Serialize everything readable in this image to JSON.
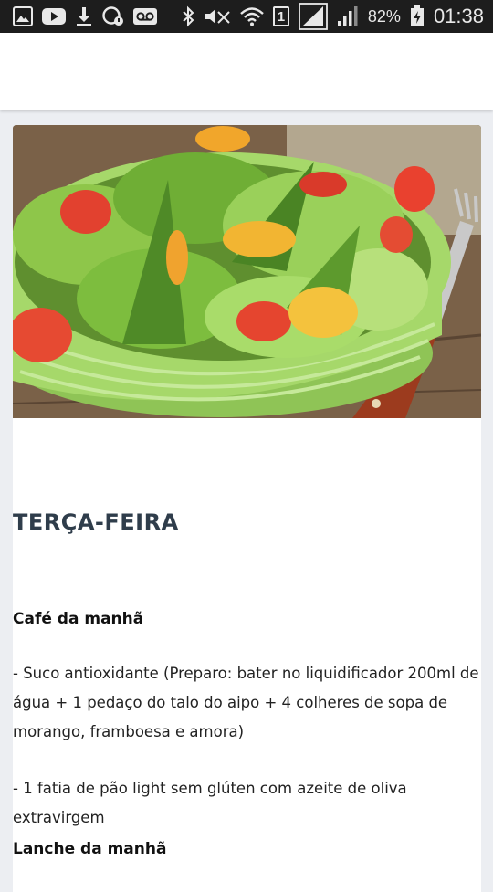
{
  "status_bar": {
    "battery_percent": "82%",
    "time": "01:38",
    "sim_label": "1",
    "left_icons": [
      "gallery-icon",
      "youtube-icon",
      "download-icon",
      "whatsapp-icon",
      "voicemail-icon"
    ],
    "right_icons": [
      "bluetooth-icon",
      "mute-icon",
      "wifi-icon",
      "sim-icon",
      "signal-icon",
      "signal-icon",
      "battery-charging-icon"
    ]
  },
  "colors": {
    "status_bar_bg": "#1d1d1d",
    "page_bg": "#eceef2",
    "title_color": "#2f3d4b",
    "bowl_green": "#a6d86a"
  },
  "article": {
    "hero_image": "salad-bowl-image",
    "day_title": "TERÇA-FEIRA",
    "meals": [
      {
        "title": "Café da manhã",
        "items": [
          "- Suco antioxidante (Preparo: bater no liquidificador 200ml de água + 1 pedaço do talo do aipo + 4 colheres de sopa de morango, framboesa e amora)",
          "- 1 fatia de pão light sem glúten com azeite de oliva extravirgem"
        ]
      },
      {
        "title": "Lanche da manhã",
        "items": []
      }
    ]
  }
}
